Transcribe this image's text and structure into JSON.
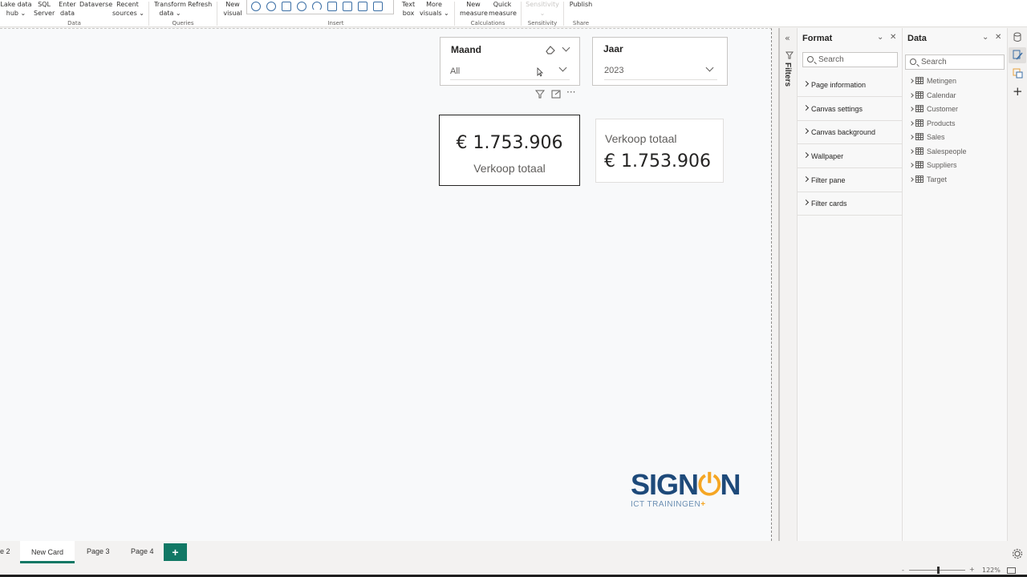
{
  "ribbon": {
    "data": {
      "onelake": [
        "Lake data",
        "hub"
      ],
      "sql": [
        "SQL",
        "Server"
      ],
      "enter": [
        "Enter",
        "data"
      ],
      "dataverse": "Dataverse",
      "recent": [
        "Recent",
        "sources"
      ],
      "label": "Data"
    },
    "queries": {
      "transform": [
        "Transform",
        "data"
      ],
      "refresh": "Refresh",
      "label": "Queries"
    },
    "insert": {
      "new_visual": [
        "New",
        "visual"
      ],
      "text_box": [
        "Text",
        "box"
      ],
      "more_visuals": [
        "More",
        "visuals"
      ],
      "label": "Insert"
    },
    "calculations": {
      "new_measure": [
        "New",
        "measure"
      ],
      "quick_measure": [
        "Quick",
        "measure"
      ],
      "label": "Calculations"
    },
    "sensitivity": {
      "btn": "Sensitivity",
      "label": "Sensitivity"
    },
    "share": {
      "publish": "Publish",
      "label": "Share"
    }
  },
  "canvas": {
    "slicer_maand": {
      "title": "Maand",
      "value": "All"
    },
    "slicer_jaar": {
      "title": "Jaar",
      "value": "2023"
    },
    "card1": {
      "value": "€ 1.753.906",
      "label": "Verkoop totaal"
    },
    "card2": {
      "label": "Verkoop totaal",
      "value": "€ 1.753.906"
    },
    "logo": {
      "part1": "SIGN",
      "part2": "N",
      "tagline": "ICT TRAININGEN",
      "plus": "+"
    }
  },
  "filters": {
    "label": "Filters"
  },
  "format_pane": {
    "title": "Format",
    "search_placeholder": "Search",
    "items": [
      "Page information",
      "Canvas settings",
      "Canvas background",
      "Wallpaper",
      "Filter pane",
      "Filter cards"
    ]
  },
  "data_pane": {
    "title": "Data",
    "search_placeholder": "Search",
    "tables": [
      "Metingen",
      "Calendar",
      "Customer",
      "Products",
      "Sales",
      "Salespeople",
      "Suppliers",
      "Target"
    ]
  },
  "tabs": {
    "partial": "e 2",
    "active": "New Card",
    "page3": "Page 3",
    "page4": "Page 4",
    "add": "+"
  },
  "status": {
    "zoom": "122%"
  },
  "colors": {
    "accent": "#117865",
    "logo_blue": "#1e4a7a",
    "logo_orange": "#f5a623"
  }
}
